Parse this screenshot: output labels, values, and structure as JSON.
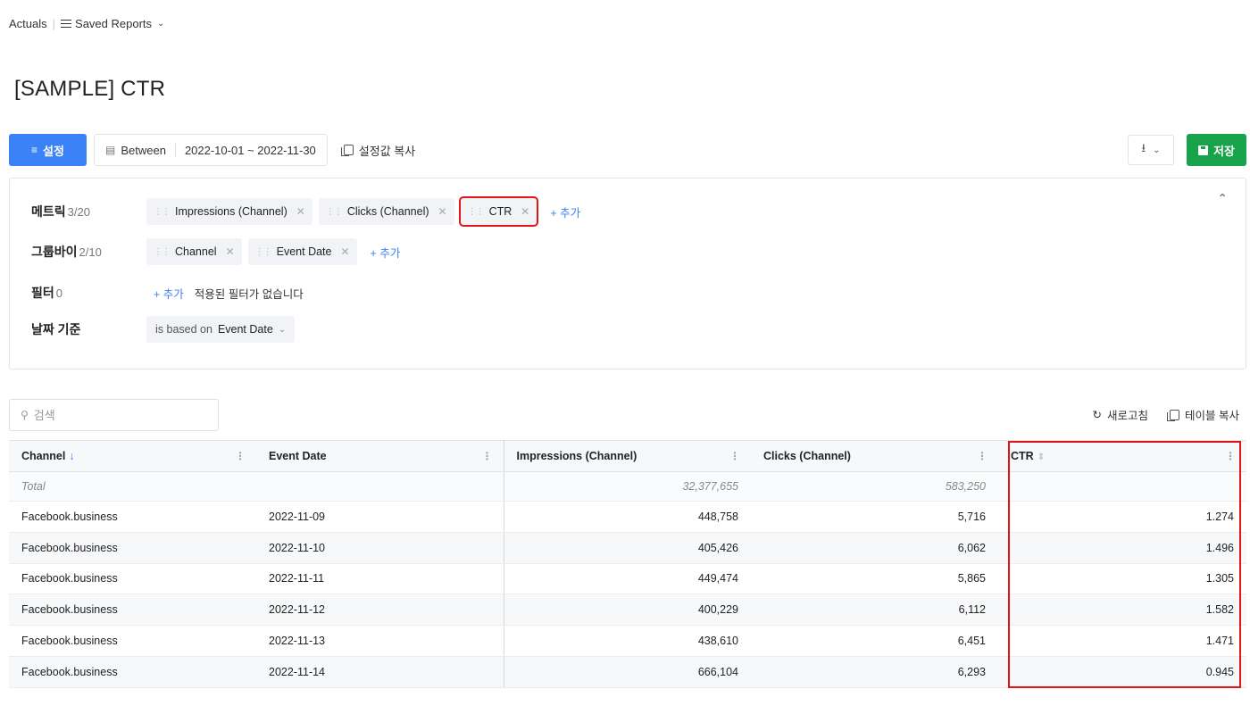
{
  "nav": {
    "section": "Actuals",
    "saved_reports": "Saved Reports"
  },
  "page_title": "[SAMPLE] CTR",
  "toolbar": {
    "settings_label": "설정",
    "date_mode": "Between",
    "date_range": "2022-10-01 ~ 2022-11-30",
    "copy_settings": "설정값 복사",
    "save_label": "저장"
  },
  "config": {
    "metrics": {
      "label": "메트릭",
      "count": "3/20",
      "items": [
        "Impressions (Channel)",
        "Clicks (Channel)",
        "CTR"
      ],
      "add": "+ 추가"
    },
    "groupby": {
      "label": "그룹바이",
      "count": "2/10",
      "items": [
        "Channel",
        "Event Date"
      ],
      "add": "+ 추가"
    },
    "filter": {
      "label": "필터",
      "count": "0",
      "add": "+ 추가",
      "empty": "적용된 필터가 없습니다"
    },
    "date_basis": {
      "label": "날짜 기준",
      "prefix": "is based on",
      "value": "Event Date"
    }
  },
  "search": {
    "placeholder": "검색"
  },
  "table_tools": {
    "refresh": "새로고침",
    "copy_table": "테이블 복사"
  },
  "table": {
    "columns": [
      "Channel",
      "Event Date",
      "Impressions (Channel)",
      "Clicks (Channel)",
      "CTR"
    ],
    "total": {
      "label": "Total",
      "impressions": "32,377,655",
      "clicks": "583,250"
    },
    "rows": [
      [
        "Facebook.business",
        "2022-11-09",
        "448,758",
        "5,716",
        "1.274"
      ],
      [
        "Facebook.business",
        "2022-11-10",
        "405,426",
        "6,062",
        "1.496"
      ],
      [
        "Facebook.business",
        "2022-11-11",
        "449,474",
        "5,865",
        "1.305"
      ],
      [
        "Facebook.business",
        "2022-11-12",
        "400,229",
        "6,112",
        "1.582"
      ],
      [
        "Facebook.business",
        "2022-11-13",
        "438,610",
        "6,451",
        "1.471"
      ],
      [
        "Facebook.business",
        "2022-11-14",
        "666,104",
        "6,293",
        "0.945"
      ]
    ]
  },
  "colors": {
    "primary": "#3b82f6",
    "save": "#16a34a",
    "highlight": "#e01515"
  }
}
